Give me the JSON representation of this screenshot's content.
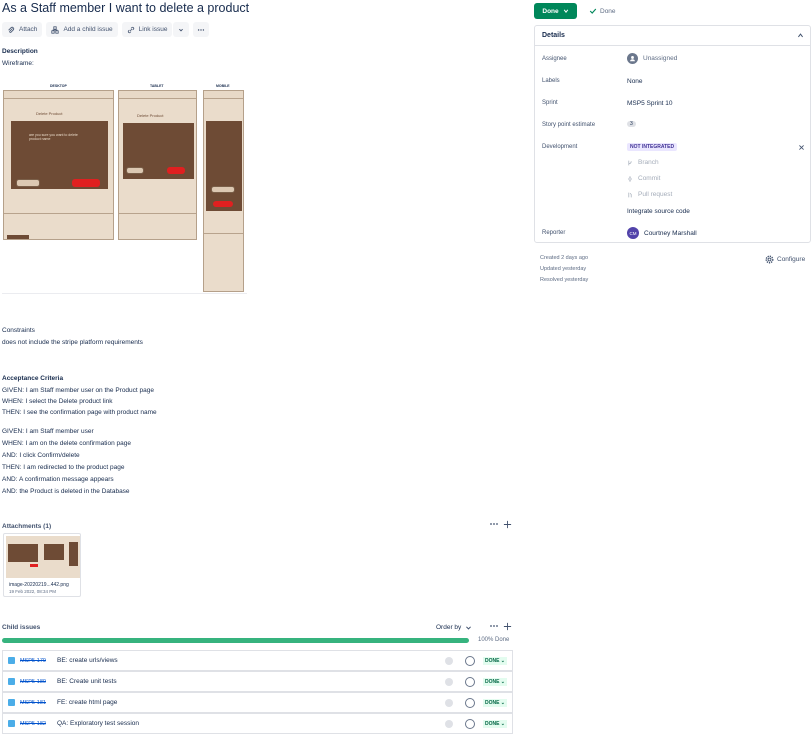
{
  "issue": {
    "title": "As a Staff member I want to delete a product"
  },
  "toolbar": {
    "attach": "Attach",
    "add_child": "Add a child issue",
    "link_issue": "Link issue",
    "more_icon": "ellipsis-icon"
  },
  "status": {
    "button": "Done",
    "resolution": "Done"
  },
  "description": {
    "heading": "Description",
    "wireframe_label": "Wireframe:",
    "wf_labels": [
      "DESKTOP",
      "TABLET",
      "MOBILE"
    ],
    "wf_delete_title": "Delete Product",
    "wf_message": "are you sure you want to delete product name",
    "wf_cancel": "cancel",
    "wf_yes": "Yes",
    "constraints_heading": "Constraints",
    "constraints_text": "does not include the stripe platform requirements",
    "ac_heading": "Acceptance Criteria",
    "ac_block1": [
      "GIVEN: I am Staff member user on the Product page",
      "WHEN: I select the Delete product link",
      "THEN: I see the confirmation page with product name"
    ],
    "ac_block2": [
      "GIVEN: I am Staff member user",
      "WHEN: I am on the delete confirmation page",
      "AND: I click Confirm/delete",
      "THEN: I am redirected to the product page",
      "AND: A confirmation message appears",
      "AND: the Product is deleted in the Database"
    ]
  },
  "attachments": {
    "heading": "Attachments (1)",
    "filename": "image-20220219...442.png",
    "date": "19 Feb 2022, 08:34 PM"
  },
  "child_issues": {
    "heading": "Child issues",
    "order_by": "Order by",
    "progress_text": "100% Done",
    "progress_fraction": 1.0,
    "items": [
      {
        "key": "MSP5-179",
        "summary": "BE: create urls/views",
        "status": "DONE"
      },
      {
        "key": "MSP5-180",
        "summary": "BE: Create unit tests",
        "status": "DONE"
      },
      {
        "key": "MSP5-181",
        "summary": "FE: create html page",
        "status": "DONE"
      },
      {
        "key": "MSP5-182",
        "summary": "QA: Exploratory test session",
        "status": "DONE"
      }
    ]
  },
  "details": {
    "heading": "Details",
    "assignee_label": "Assignee",
    "assignee_value": "Unassigned",
    "labels_label": "Labels",
    "labels_value": "None",
    "sprint_label": "Sprint",
    "sprint_value": "MSP5 Sprint 10",
    "story_points_label": "Story point estimate",
    "story_points_value": "3",
    "development_label": "Development",
    "development_badge": "NOT INTEGRATED",
    "dev_branch": "Branch",
    "dev_commit": "Commit",
    "dev_pull_request": "Pull request",
    "integrate_link": "Integrate source code",
    "reporter_label": "Reporter",
    "reporter_initials": "CM",
    "reporter_name": "Courtney Marshall"
  },
  "meta": {
    "created": "Created 2 days ago",
    "updated": "Updated yesterday",
    "resolved": "Resolved yesterday",
    "configure": "Configure"
  },
  "colors": {
    "done_green": "#00875a",
    "progress_green": "#36b37e",
    "link_blue": "#0052cc",
    "wireframe_brown": "#6e4b35",
    "wireframe_beige": "#eadccb",
    "wireframe_red": "#e02020"
  }
}
